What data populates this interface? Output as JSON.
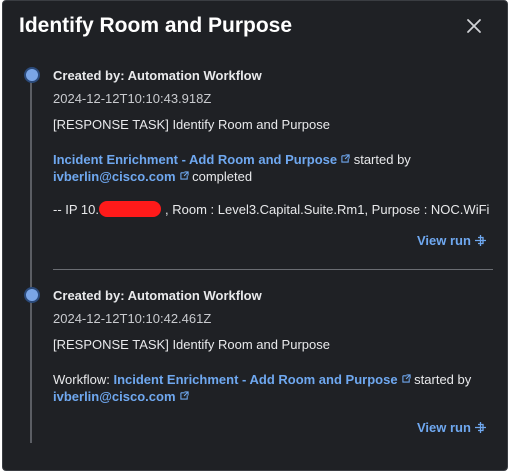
{
  "header": {
    "title": "Identify Room and Purpose",
    "close_icon": "close-icon"
  },
  "entries": [
    {
      "created_by": "Created by: Automation Workflow",
      "timestamp": "2024-12-12T10:10:43.918Z",
      "task": "[RESPONSE TASK] Identify Room and Purpose",
      "workflow_link": "Incident Enrichment - Add Room and Purpose",
      "started_by_text": "started by",
      "user_link": "ivberlin@cisco.com",
      "status_text": "completed",
      "result_prefix": "-- IP 10.",
      "result_suffix": ", Room : Level3.Capital.Suite.Rm1, Purpose : NOC.WiFi",
      "view_run": "View run"
    },
    {
      "created_by": "Created by: Automation Workflow",
      "timestamp": "2024-12-12T10:10:42.461Z",
      "task": "[RESPONSE TASK] Identify Room and Purpose",
      "workflow_label": "Workflow:",
      "workflow_link": "Incident Enrichment - Add Room and Purpose",
      "started_by_text": "started by",
      "user_link": "ivberlin@cisco.com",
      "view_run": "View run"
    }
  ],
  "colors": {
    "panel_bg": "#1f2125",
    "link": "#6fa8f0",
    "dot": "#7aa5e6",
    "redaction": "#ff1a1a"
  }
}
